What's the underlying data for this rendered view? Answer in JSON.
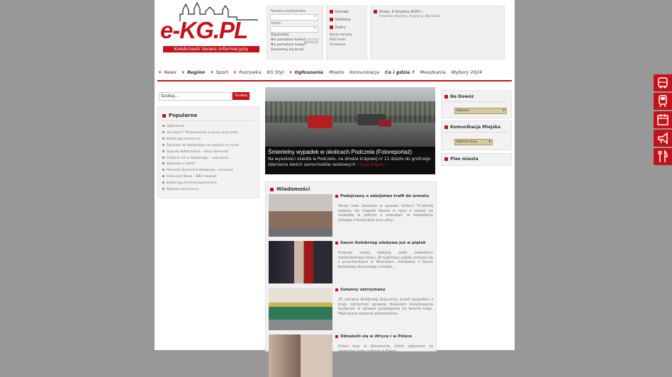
{
  "brand": {
    "logo_text": "e-KG.PL",
    "tagline": "Kołobrzeski Serwis Informacyjny"
  },
  "login": {
    "login_label": "Nazwa użytkownika",
    "password_label": "Hasło",
    "remember_label": "Zapamiętaj",
    "submit_label": "Zaloguj",
    "forgot_password": "Nie pamiętasz hasła?",
    "forgot_username": "Nie pamiętasz nazwy?",
    "register": "Zarejestruj się teraz!"
  },
  "links": {
    "items": [
      "Kontakt",
      "Reklama",
      "Kadry"
    ],
    "extra": [
      "Nasze serwisy",
      "RSS feeds",
      "Archiwum"
    ]
  },
  "info": {
    "date": "Środa, 4 Grudnia 2024 r.",
    "line2": "Imieniny: Barbary, Krystyny, Bernardy"
  },
  "nav": {
    "items": [
      {
        "label": "News",
        "red": false,
        "arrow": true
      },
      {
        "label": "Region",
        "red": true,
        "arrow": true
      },
      {
        "label": "Sport",
        "red": false,
        "arrow": true
      },
      {
        "label": "Rozrywka",
        "red": false,
        "arrow": true
      },
      {
        "label": "KG Styl",
        "red": false,
        "arrow": false
      },
      {
        "label": "Ogłoszenia",
        "red": true,
        "arrow": true
      },
      {
        "label": "Miasto",
        "red": false,
        "arrow": false
      },
      {
        "label": "Komunikacja",
        "red": false,
        "arrow": false
      },
      {
        "label": "Co i gdzie ?",
        "red": true,
        "arrow": false
      },
      {
        "label": "Mieszkania",
        "red": false,
        "arrow": false
      },
      {
        "label": "Wybory 2024",
        "red": false,
        "arrow": false
      }
    ]
  },
  "search": {
    "value": "Szukaj...",
    "button": "Szukaj"
  },
  "popular": {
    "title": "Popularne",
    "items": [
      "Ogłoszenia",
      "Ale kwas!!! Poszukiwanie w pracy oraz pracy",
      "Kołobrzeg umocni się",
      "Dyskusja we Kołobrzegu ma wyjście na rynek",
      "Sygnały Kołobrzeskie – Kasy (dziennik)",
      "Ostatnie dni w Kołobrzegu – najnowsze",
      "Wywiady z ludźmi",
      "Pomorze Zachodnie Kołobrzeg – przemysł",
      "Gdzie jest Nowa – BBC (dawne)",
      "Kołobrzeg Zachodniopomorskie",
      "Wywiad zakończony"
    ]
  },
  "feature": {
    "title": "Śmiertelny wypadek w okolicach Podczela (Fotoreportaż)",
    "desc": "Na wysokości osiedla w Podczelu, na drodze krajowej nr 11 doszło do groźnego zderzenia dwóch samochodów osobowych",
    "more": "Czytaj więcej »"
  },
  "news": {
    "title": "Wiadomości",
    "items": [
      {
        "title": "Podejrzany o zabójstwo trafił do aresztu",
        "text": "Wciąż trwa śledztwo w sprawie śmierci 75-letniej kobiety. Do tragedii doszło w nocy z soboty na niedzielę w jednym z mieszkań, w mieszkaniu jednego z budynków przy ulicy..."
      },
      {
        "title": "Saxon Kołobrzeg zdobywa już w piątek",
        "text": "Podczas nowej kolejnej walki zawodnicy kołobrzeskiego klubu, W najbliższy piątek zmierzą się z przeciwnikami w Wrocławiu, młodzieży z Saxon Kołobrzeg skorzystają z kolejki..."
      },
      {
        "title": "Sutanny zatrzymany",
        "text": "25 czerwca Kołobrzeg Sojusznicy przed wyjazdem z kraju zatrzymali sprawcę Nakazem Aresztowania wydanym w sprawie przestępstw na terenie kraju. Mężczyzna zostanie przewieziony."
      },
      {
        "title": "Odnaleźli się w Afryce i w Polsce",
        "text": "Dzieci były w Kamerunie, które zgłoszono za zaginione przez rodzinę w Polsce..."
      }
    ]
  },
  "right": {
    "nadowoz": {
      "title": "Na Dowóz",
      "select": "Wybierz"
    },
    "komunikacja": {
      "title": "Komunikacja Miejska",
      "select": "Wybierz linię"
    },
    "plan": {
      "title": "Plan miasta"
    }
  },
  "side_icons": [
    "bus-icon",
    "train-icon",
    "calendar-icon",
    "megaphone-icon",
    "restaurant-icon"
  ]
}
